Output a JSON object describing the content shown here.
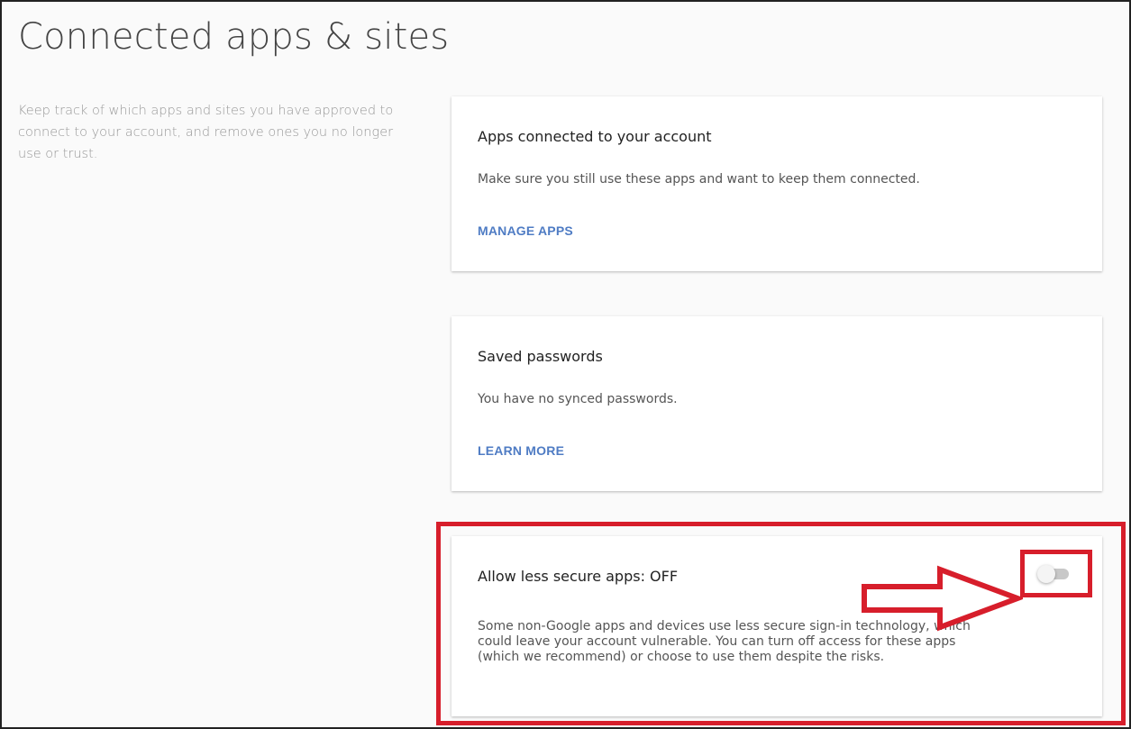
{
  "page": {
    "title": "Connected apps & sites",
    "description": "Keep track of which apps and sites you have approved to connect to your account, and remove ones you no longer use or trust."
  },
  "cards": {
    "apps": {
      "title": "Apps connected to your account",
      "text": "Make sure you still use these apps and want to keep them connected.",
      "link": "MANAGE APPS"
    },
    "passwords": {
      "title": "Saved passwords",
      "text": "You have no synced passwords.",
      "link": "LEARN MORE"
    },
    "less_secure": {
      "title": "Allow less secure apps: OFF",
      "text": "Some non-Google apps and devices use less secure sign-in technology, which could leave your account vulnerable. You can turn off access for these apps (which we recommend) or choose to use them despite the risks.",
      "toggle_state": "off"
    }
  },
  "colors": {
    "link": "#4f7cc4",
    "annotation": "#d71e2b",
    "toggle_track_off": "#c8c8c8",
    "toggle_knob_off": "#f4f4f4"
  },
  "icons": {
    "annotation_arrow": "right-arrow-icon"
  }
}
